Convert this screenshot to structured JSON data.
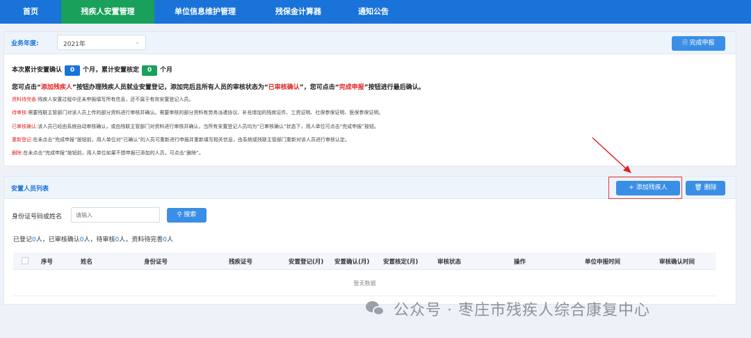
{
  "nav": {
    "items": [
      {
        "label": "首页"
      },
      {
        "label": "残疾人安置管理"
      },
      {
        "label": "单位信息维护管理"
      },
      {
        "label": "残保金计算器"
      },
      {
        "label": "通知公告"
      }
    ],
    "active_index": 1
  },
  "year": {
    "label": "业务年度:",
    "value": "2021年"
  },
  "complete_button": {
    "icon": "document-icon",
    "label": "完成申报"
  },
  "summary": {
    "prefix": "本次累计安置确认",
    "confirm_count": "0",
    "mid": "个月，累计安置核定",
    "verify_count": "0",
    "suffix": "个月"
  },
  "instruction": {
    "part1": "您可点击“",
    "add_key": "添加残疾人",
    "part2": "”按钮办理残疾人员就业安置登记，添加完后且所有人员的审核状态为“",
    "audited_key": "已审核确认",
    "part3": "”，您可点击“",
    "complete_key": "完成申报",
    "part4": "”按钮进行最后确认。"
  },
  "notes": [
    {
      "key": "资料待完善:",
      "text": "残疾人安置过程中还未申报填写所有信息，还不属于有效安置登记人员。"
    },
    {
      "key": "待审核:",
      "text": "需要残联主管部门对该人员上传的部分资料进行审核并确认。需要审核的部分资料有劳务派遣协议、补充增加的残疾证件、工资证明、社保参保证明、医保参保证明。"
    },
    {
      "key": "已审核确认:",
      "text": "该人员已经由系统自动审核确认，或由残联主管部门对资料进行审核并确认，当所有安置登记人员均为“已审核确认”状态下，用人单位可点击“完成申报”按钮。"
    },
    {
      "key": "重新登记:",
      "text": "在未点击“完成申报”按钮前，用人单位对“已确认”的人员可重新进行申报并重新填写相关信息，由系统或残联主管部门重新对该人员进行审核认定。"
    },
    {
      "key": "删除:",
      "text": "在未点击“完成申报”按钮前，用人单位如果不想申报已添加的人员，可点击“删除”。"
    }
  ],
  "list": {
    "title": "安置人员列表",
    "add_button": {
      "icon": "plus-icon",
      "label": "添加残疾人"
    },
    "delete_button": {
      "icon": "trash-icon",
      "label": "删除"
    }
  },
  "search": {
    "label": "身份证号码或姓名",
    "placeholder": "请输入",
    "value": "",
    "button_label": "搜索"
  },
  "stats": {
    "p1": "已登记",
    "registered": "0",
    "p2": "人，已审核确认",
    "confirmed": "0",
    "p3": "人，待审核",
    "pending": "0",
    "p4": "人，资料待完善",
    "incomplete": "0",
    "p5": "人"
  },
  "table": {
    "columns": [
      "序号",
      "姓名",
      "身份证号",
      "残疾证号",
      "安置登记(月)",
      "安置确认(月)",
      "安置核定(月)",
      "审核状态",
      "操作",
      "单位申报时间",
      "审核确认时间"
    ],
    "empty_text": "暂无数据"
  },
  "watermark": {
    "icon": "wechat-icon",
    "text": "公众号 · 枣庄市残疾人综合康复中心"
  },
  "colors": {
    "primary": "#1a73d9",
    "active_nav": "#19a05a",
    "button": "#3a8ee6",
    "highlight": "#e02020"
  }
}
